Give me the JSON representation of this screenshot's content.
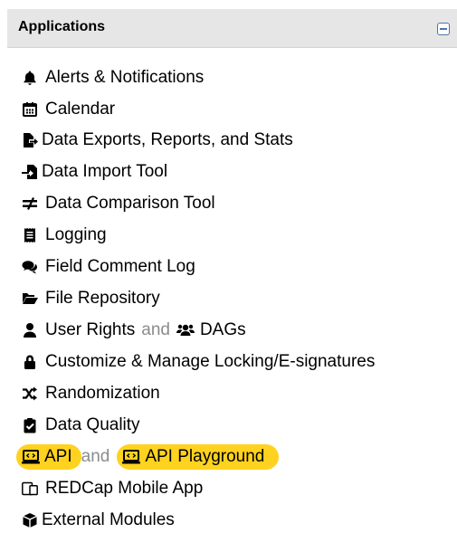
{
  "header": {
    "title": "Applications"
  },
  "items": [
    {
      "label": "Alerts & Notifications"
    },
    {
      "label": "Calendar"
    },
    {
      "label": "Data Exports, Reports, and Stats"
    },
    {
      "label": "Data Import Tool"
    },
    {
      "label": "Data Comparison Tool"
    },
    {
      "label": "Logging"
    },
    {
      "label": "Field Comment Log"
    },
    {
      "label": "File Repository"
    },
    {
      "label": "User Rights",
      "joiner": "and",
      "label2": "DAGs"
    },
    {
      "label": "Customize & Manage Locking/E-signatures"
    },
    {
      "label": "Randomization"
    },
    {
      "label": "Data Quality"
    },
    {
      "label": "API",
      "joiner": "and",
      "label2": "API Playground"
    },
    {
      "label": "REDCap Mobile App"
    },
    {
      "label": "External Modules"
    }
  ],
  "colors": {
    "highlight": "#ffd21f",
    "header_bg": "#e6e6e6",
    "joiner_text": "#8c8c8c"
  }
}
